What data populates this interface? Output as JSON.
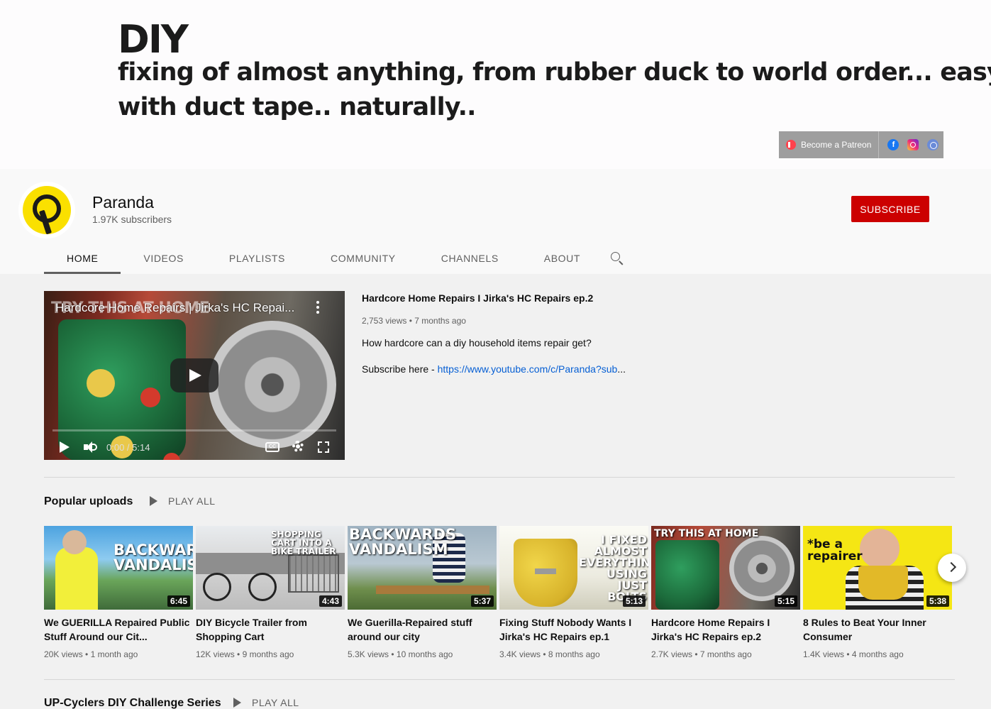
{
  "banner": {
    "heading": "DIY",
    "line1": "fixing of almost anything, from rubber duck to world order... easy..",
    "line2": "with duct tape.. naturally..",
    "patreon_label": "Become a Patreon",
    "social_icons": [
      "facebook-icon",
      "instagram-icon",
      "website-icon"
    ]
  },
  "channel": {
    "name": "Paranda",
    "subscribers": "1.97K subscribers",
    "subscribe_label": "SUBSCRIBE",
    "tabs": [
      "HOME",
      "VIDEOS",
      "PLAYLISTS",
      "COMMUNITY",
      "CHANNELS",
      "ABOUT"
    ],
    "active_tab": "HOME"
  },
  "featured": {
    "player_title": "Hardcore Home Repairs | Jirka's HC Repai...",
    "overlay_text": "TRY THIS AT HOME",
    "time": "0:00 / 5:14",
    "title": "Hardcore Home Repairs I Jirka's HC Repairs ep.2",
    "meta": "2,753 views • 7 months ago",
    "description": "How hardcore can a diy household items repair get?",
    "subscribe_prefix": "Subscribe here - ",
    "subscribe_link": "https://www.youtube.com/c/Paranda?sub",
    "subscribe_ellipsis": "..."
  },
  "popular": {
    "title": "Popular uploads",
    "play_all": "PLAY ALL",
    "videos": [
      {
        "title": "We GUERILLA Repaired Public Stuff Around our Cit...",
        "views": "20K views",
        "age": "1 month ago",
        "duration": "6:45",
        "thumb_text": "BACKWARDS VANDALISM"
      },
      {
        "title": "DIY Bicycle Trailer from Shopping Cart",
        "views": "12K views",
        "age": "9 months ago",
        "duration": "4:43",
        "thumb_text": "SHOPPING CART INTO A BIKE TRAILER"
      },
      {
        "title": "We Guerilla-Repaired stuff around our city",
        "views": "5.3K views",
        "age": "10 months ago",
        "duration": "5:37",
        "thumb_text": "BACKWARDS VANDALISM"
      },
      {
        "title": "Fixing Stuff Nobody Wants I Jirka's HC Repairs ep.1",
        "views": "3.4K views",
        "age": "8 months ago",
        "duration": "5:13",
        "thumb_text": "I FIXED ALMOST EVERYTHING USING JUST BOLTS"
      },
      {
        "title": "Hardcore Home Repairs I Jirka's HC Repairs ep.2",
        "views": "2.7K views",
        "age": "7 months ago",
        "duration": "5:15",
        "thumb_text": "TRY THIS AT HOME"
      },
      {
        "title": "8 Rules to Beat Your Inner Consumer",
        "views": "1.4K views",
        "age": "4 months ago",
        "duration": "5:38",
        "thumb_text": "*be a repairer"
      }
    ]
  },
  "upcyclers": {
    "title": "UP-Cyclers DIY Challenge Series",
    "play_all": "PLAY ALL"
  },
  "meta_separator": " • "
}
